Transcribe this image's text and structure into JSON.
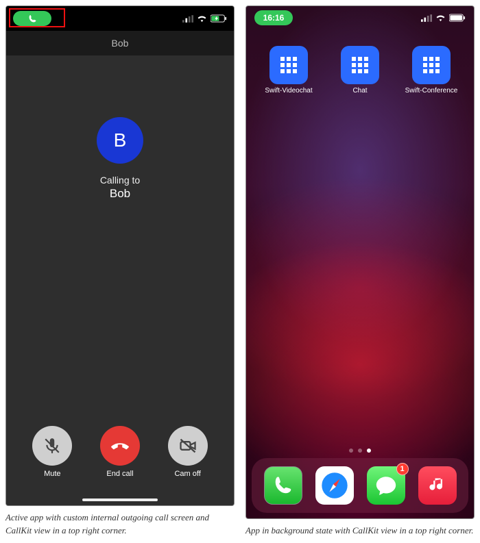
{
  "left": {
    "status": {
      "callkit_pill_visible": true
    },
    "header": {
      "title": "Bob"
    },
    "avatar_initial": "B",
    "status_text": "Calling to",
    "callee": "Bob",
    "controls": {
      "mute": "Mute",
      "end": "End call",
      "cam": "Cam off"
    },
    "caption": "Active app with custom internal outgoing call screen and CallKit view in a top right corner."
  },
  "right": {
    "status_time": "16:16",
    "apps": [
      {
        "label": "Swift-Videochat"
      },
      {
        "label": "Chat"
      },
      {
        "label": "Swift-Conference"
      }
    ],
    "page_count": 3,
    "active_page_index": 2,
    "dock": {
      "phone_icon": "phone",
      "safari_icon": "safari",
      "messages_icon": "messages",
      "messages_badge": "1",
      "music_icon": "music"
    },
    "caption": "App in background state with CallKit view in a top right corner."
  }
}
